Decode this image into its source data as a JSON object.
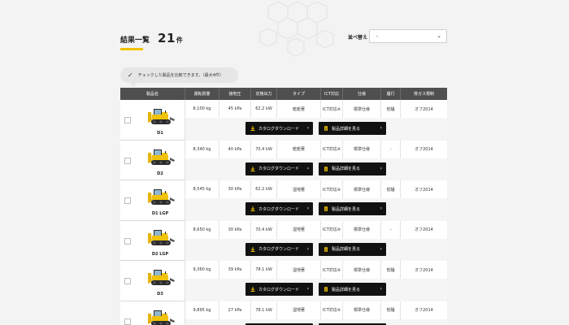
{
  "header": {
    "results_label": "結果一覧",
    "results_count": "21",
    "results_unit": "件",
    "sort_label": "並べ替え",
    "sort_value": "-"
  },
  "compare_hint": "チェックした製品を比較できます。（最大4件）",
  "table": {
    "columns": [
      "製品名",
      "運転質量",
      "接地圧",
      "定格出力",
      "タイプ",
      "ICT対応",
      "仕様",
      "履行",
      "排ガス規制"
    ],
    "rows": [
      {
        "name": "D1",
        "weight": "8,100 kg",
        "pressure": "45 kPa",
        "power": "62.2 kW",
        "type": "乾乾著",
        "ict": "ICT対応※",
        "spec": "標準仕様",
        "track": "低騒",
        "emission": "オフ2014"
      },
      {
        "name": "D2",
        "weight": "8,340 kg",
        "pressure": "40 kPa",
        "power": "70.4 kW",
        "type": "乾乾著",
        "ict": "ICT対応※",
        "spec": "標準仕様",
        "track": "-",
        "emission": "オフ2014"
      },
      {
        "name": "D1 LGP",
        "weight": "8,545 kg",
        "pressure": "30 kPa",
        "power": "62.2 kW",
        "type": "湿地著",
        "ict": "ICT対応※",
        "spec": "標準仕様",
        "track": "低騒",
        "emission": "オフ2014"
      },
      {
        "name": "D2 LGP",
        "weight": "8,650 kg",
        "pressure": "30 kPa",
        "power": "70.4 kW",
        "type": "湿地著",
        "ict": "ICT対応※",
        "spec": "標準仕様",
        "track": "-",
        "emission": "オフ2014"
      },
      {
        "name": "D3",
        "weight": "9,360 kg",
        "pressure": "39 kPa",
        "power": "78.1 kW",
        "type": "湿地著",
        "ict": "ICT対応※",
        "spec": "標準仕様",
        "track": "低騒",
        "emission": "オフ2014"
      },
      {
        "name": "",
        "weight": "9,895 kg",
        "pressure": "27 kPa",
        "power": "78.1 kW",
        "type": "湿地著",
        "ict": "ICT対応※",
        "spec": "標準仕様",
        "track": "低騒",
        "emission": "オフ2014"
      }
    ]
  },
  "buttons": {
    "catalog_download": "カタログダウンロード",
    "product_details": "製品詳細を見る"
  },
  "colors": {
    "accent": "#f2c200",
    "header_bg": "#4f4f4f",
    "button_bg": "#111111",
    "dozer_yellow": "#f0c20a"
  },
  "icons": [
    "hexagon-pattern-decoration",
    "chevron-down-icon",
    "check-icon",
    "download-icon",
    "document-icon",
    "chevron-right-icon",
    "bulldozer-image"
  ]
}
